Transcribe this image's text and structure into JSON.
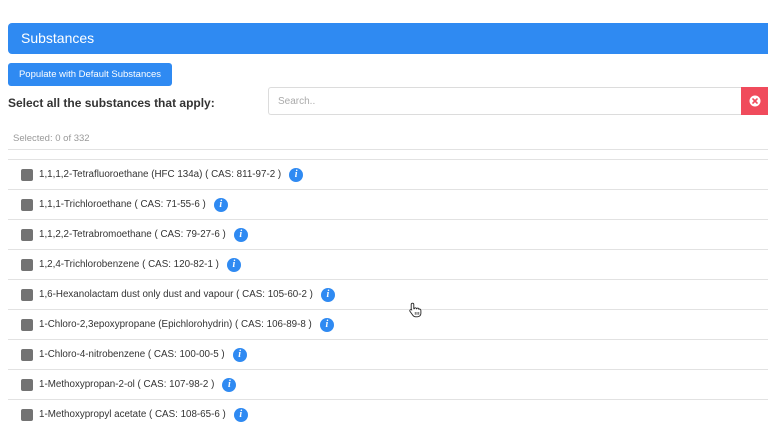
{
  "header": {
    "title": "Substances"
  },
  "toolbar": {
    "populate_label": "Populate with Default Substances"
  },
  "selection": {
    "prompt": "Select all the substances that apply:",
    "count_text": "Selected: 0 of 332"
  },
  "search": {
    "placeholder": "Search.."
  },
  "list": {
    "items": [
      {
        "label": "1,1,1,2-Tetrafluoroethane (HFC 134a) ( CAS: 811-97-2 )"
      },
      {
        "label": "1,1,1-Trichloroethane ( CAS: 71-55-6 )"
      },
      {
        "label": "1,1,2,2-Tetrabromoethane ( CAS: 79-27-6 )"
      },
      {
        "label": "1,2,4-Trichlorobenzene ( CAS: 120-82-1 )"
      },
      {
        "label": "1,6-Hexanolactam dust only dust and vapour ( CAS: 105-60-2 )"
      },
      {
        "label": "1-Chloro-2,3epoxypropane (Epichlorohydrin) ( CAS: 106-89-8 )"
      },
      {
        "label": "1-Chloro-4-nitrobenzene ( CAS: 100-00-5 )"
      },
      {
        "label": "1-Methoxypropan-2-ol ( CAS: 107-98-2 )"
      },
      {
        "label": "1-Methoxypropyl acetate ( CAS: 108-65-6 )"
      }
    ]
  },
  "icons": {
    "info": "info-icon",
    "clear": "close-circle-icon",
    "cursor": "hand-pointer-icon"
  },
  "colors": {
    "primary": "#2f8af2",
    "danger": "#f04b5c",
    "checkbox": "#737373"
  }
}
